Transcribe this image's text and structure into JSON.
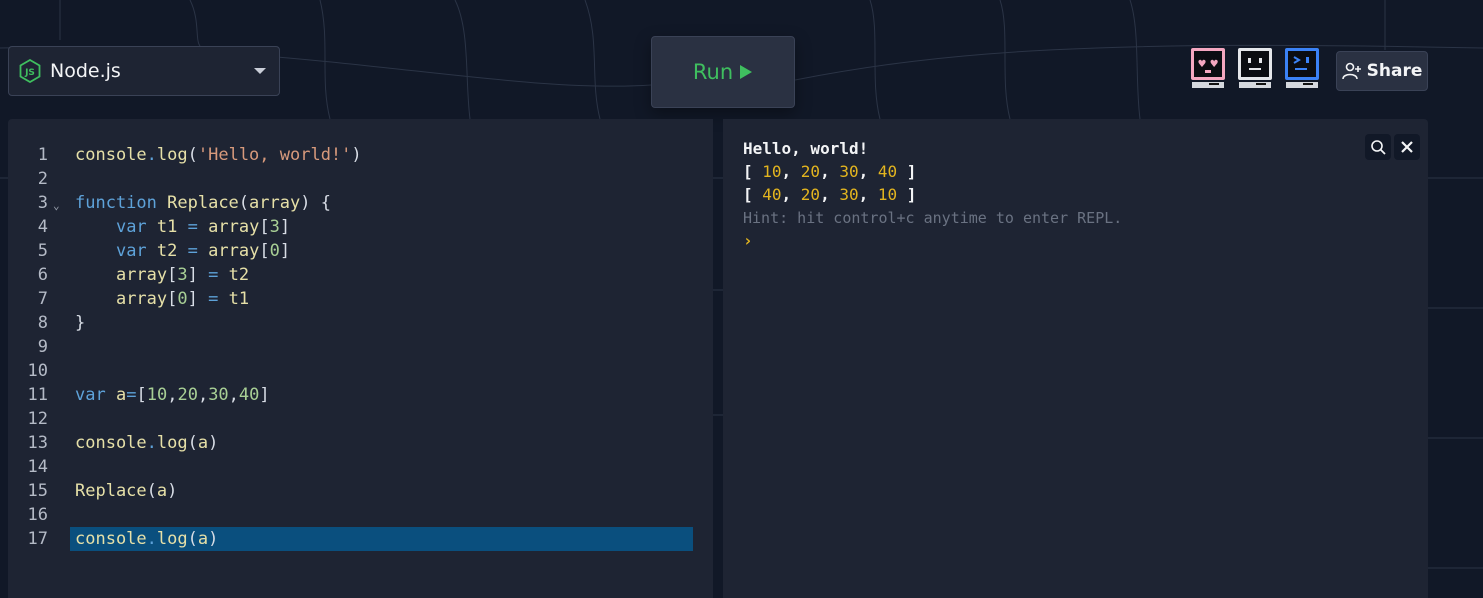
{
  "language_select": {
    "label": "Node.js",
    "icon": "nodejs-icon"
  },
  "run_button": {
    "label": "Run",
    "icon": "play-icon",
    "color": "#3fbf5f"
  },
  "avatars": [
    {
      "name": "heart-eyes-computer-avatar",
      "accent": "#f4a7c0"
    },
    {
      "name": "neutral-face-computer-avatar",
      "accent": "#e5e7eb"
    },
    {
      "name": "terminal-prompt-computer-avatar",
      "accent": "#3b82f6"
    }
  ],
  "share_button": {
    "label": "Share",
    "icon": "user-plus-icon"
  },
  "editor": {
    "lines": [
      {
        "n": "1",
        "text": "console.log('Hello, world!')"
      },
      {
        "n": "2",
        "text": ""
      },
      {
        "n": "3",
        "text": "function Replace(array) {",
        "fold": "⌄"
      },
      {
        "n": "4",
        "text": "    var t1 = array[3]"
      },
      {
        "n": "5",
        "text": "    var t2 = array[0]"
      },
      {
        "n": "6",
        "text": "    array[3] = t2"
      },
      {
        "n": "7",
        "text": "    array[0] = t1"
      },
      {
        "n": "8",
        "text": "}"
      },
      {
        "n": "9",
        "text": ""
      },
      {
        "n": "10",
        "text": ""
      },
      {
        "n": "11",
        "text": "var a=[10,20,30,40]"
      },
      {
        "n": "12",
        "text": ""
      },
      {
        "n": "13",
        "text": "console.log(a)"
      },
      {
        "n": "14",
        "text": ""
      },
      {
        "n": "15",
        "text": "Replace(a)"
      },
      {
        "n": "16",
        "text": ""
      },
      {
        "n": "17",
        "text": "console.log(a)",
        "active": true
      }
    ],
    "active_line_color": "#0a4f7e"
  },
  "console": {
    "output_1": "Hello, world!",
    "arr1": {
      "open": "[ ",
      "v": [
        "10",
        "20",
        "30",
        "40"
      ],
      "close": " ]"
    },
    "arr2": {
      "open": "[ ",
      "v": [
        "40",
        "20",
        "30",
        "10"
      ],
      "close": " ]"
    },
    "hint": "Hint: hit control+c anytime to enter REPL.",
    "prompt": "›",
    "tools": [
      "search-icon",
      "close-icon"
    ]
  }
}
